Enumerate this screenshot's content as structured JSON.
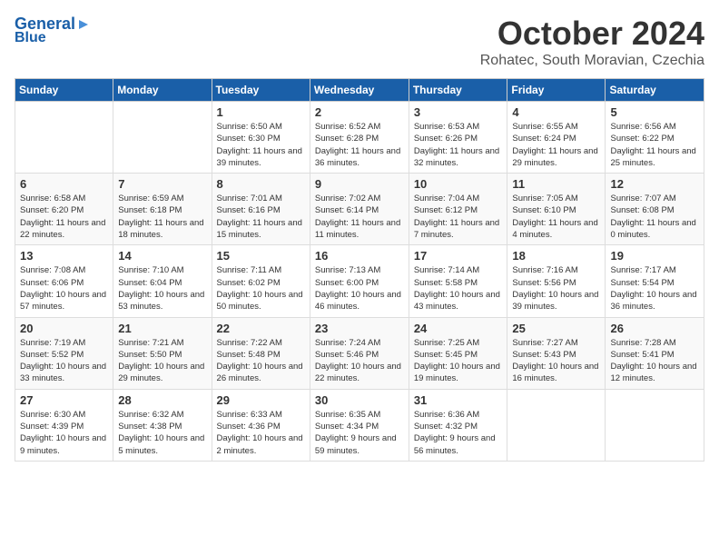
{
  "header": {
    "logo_line1": "General",
    "logo_line2": "Blue",
    "month": "October 2024",
    "location": "Rohatec, South Moravian, Czechia"
  },
  "days_of_week": [
    "Sunday",
    "Monday",
    "Tuesday",
    "Wednesday",
    "Thursday",
    "Friday",
    "Saturday"
  ],
  "weeks": [
    [
      {
        "num": "",
        "detail": ""
      },
      {
        "num": "",
        "detail": ""
      },
      {
        "num": "1",
        "detail": "Sunrise: 6:50 AM\nSunset: 6:30 PM\nDaylight: 11 hours and 39 minutes."
      },
      {
        "num": "2",
        "detail": "Sunrise: 6:52 AM\nSunset: 6:28 PM\nDaylight: 11 hours and 36 minutes."
      },
      {
        "num": "3",
        "detail": "Sunrise: 6:53 AM\nSunset: 6:26 PM\nDaylight: 11 hours and 32 minutes."
      },
      {
        "num": "4",
        "detail": "Sunrise: 6:55 AM\nSunset: 6:24 PM\nDaylight: 11 hours and 29 minutes."
      },
      {
        "num": "5",
        "detail": "Sunrise: 6:56 AM\nSunset: 6:22 PM\nDaylight: 11 hours and 25 minutes."
      }
    ],
    [
      {
        "num": "6",
        "detail": "Sunrise: 6:58 AM\nSunset: 6:20 PM\nDaylight: 11 hours and 22 minutes."
      },
      {
        "num": "7",
        "detail": "Sunrise: 6:59 AM\nSunset: 6:18 PM\nDaylight: 11 hours and 18 minutes."
      },
      {
        "num": "8",
        "detail": "Sunrise: 7:01 AM\nSunset: 6:16 PM\nDaylight: 11 hours and 15 minutes."
      },
      {
        "num": "9",
        "detail": "Sunrise: 7:02 AM\nSunset: 6:14 PM\nDaylight: 11 hours and 11 minutes."
      },
      {
        "num": "10",
        "detail": "Sunrise: 7:04 AM\nSunset: 6:12 PM\nDaylight: 11 hours and 7 minutes."
      },
      {
        "num": "11",
        "detail": "Sunrise: 7:05 AM\nSunset: 6:10 PM\nDaylight: 11 hours and 4 minutes."
      },
      {
        "num": "12",
        "detail": "Sunrise: 7:07 AM\nSunset: 6:08 PM\nDaylight: 11 hours and 0 minutes."
      }
    ],
    [
      {
        "num": "13",
        "detail": "Sunrise: 7:08 AM\nSunset: 6:06 PM\nDaylight: 10 hours and 57 minutes."
      },
      {
        "num": "14",
        "detail": "Sunrise: 7:10 AM\nSunset: 6:04 PM\nDaylight: 10 hours and 53 minutes."
      },
      {
        "num": "15",
        "detail": "Sunrise: 7:11 AM\nSunset: 6:02 PM\nDaylight: 10 hours and 50 minutes."
      },
      {
        "num": "16",
        "detail": "Sunrise: 7:13 AM\nSunset: 6:00 PM\nDaylight: 10 hours and 46 minutes."
      },
      {
        "num": "17",
        "detail": "Sunrise: 7:14 AM\nSunset: 5:58 PM\nDaylight: 10 hours and 43 minutes."
      },
      {
        "num": "18",
        "detail": "Sunrise: 7:16 AM\nSunset: 5:56 PM\nDaylight: 10 hours and 39 minutes."
      },
      {
        "num": "19",
        "detail": "Sunrise: 7:17 AM\nSunset: 5:54 PM\nDaylight: 10 hours and 36 minutes."
      }
    ],
    [
      {
        "num": "20",
        "detail": "Sunrise: 7:19 AM\nSunset: 5:52 PM\nDaylight: 10 hours and 33 minutes."
      },
      {
        "num": "21",
        "detail": "Sunrise: 7:21 AM\nSunset: 5:50 PM\nDaylight: 10 hours and 29 minutes."
      },
      {
        "num": "22",
        "detail": "Sunrise: 7:22 AM\nSunset: 5:48 PM\nDaylight: 10 hours and 26 minutes."
      },
      {
        "num": "23",
        "detail": "Sunrise: 7:24 AM\nSunset: 5:46 PM\nDaylight: 10 hours and 22 minutes."
      },
      {
        "num": "24",
        "detail": "Sunrise: 7:25 AM\nSunset: 5:45 PM\nDaylight: 10 hours and 19 minutes."
      },
      {
        "num": "25",
        "detail": "Sunrise: 7:27 AM\nSunset: 5:43 PM\nDaylight: 10 hours and 16 minutes."
      },
      {
        "num": "26",
        "detail": "Sunrise: 7:28 AM\nSunset: 5:41 PM\nDaylight: 10 hours and 12 minutes."
      }
    ],
    [
      {
        "num": "27",
        "detail": "Sunrise: 6:30 AM\nSunset: 4:39 PM\nDaylight: 10 hours and 9 minutes."
      },
      {
        "num": "28",
        "detail": "Sunrise: 6:32 AM\nSunset: 4:38 PM\nDaylight: 10 hours and 5 minutes."
      },
      {
        "num": "29",
        "detail": "Sunrise: 6:33 AM\nSunset: 4:36 PM\nDaylight: 10 hours and 2 minutes."
      },
      {
        "num": "30",
        "detail": "Sunrise: 6:35 AM\nSunset: 4:34 PM\nDaylight: 9 hours and 59 minutes."
      },
      {
        "num": "31",
        "detail": "Sunrise: 6:36 AM\nSunset: 4:32 PM\nDaylight: 9 hours and 56 minutes."
      },
      {
        "num": "",
        "detail": ""
      },
      {
        "num": "",
        "detail": ""
      }
    ]
  ]
}
